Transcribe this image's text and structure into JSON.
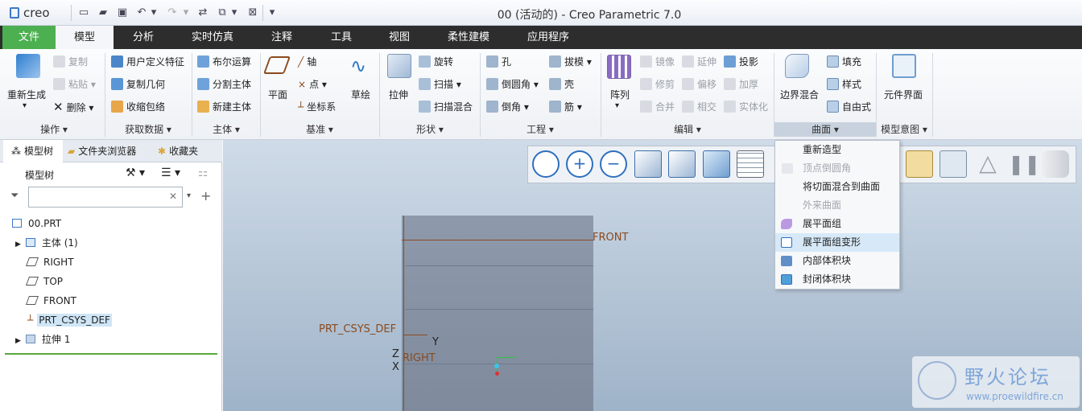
{
  "window": {
    "app_logo": "creo",
    "title": "00 (活动的) - Creo Parametric 7.0"
  },
  "ribbon_tabs": [
    "文件",
    "模型",
    "分析",
    "实时仿真",
    "注释",
    "工具",
    "视图",
    "柔性建模",
    "应用程序"
  ],
  "active_tab": "模型",
  "ribbon": {
    "operations": {
      "label": "操作",
      "regen": "重新生成",
      "copy": "复制",
      "paste": "粘贴",
      "delete": "删除"
    },
    "get_data": {
      "label": "获取数据",
      "udf": "用户定义特征",
      "copy_geom": "复制几何",
      "shrinkwrap": "收缩包络"
    },
    "body": {
      "label": "主体",
      "boolean": "布尔运算",
      "split": "分割主体",
      "new_body": "新建主体"
    },
    "datum": {
      "label": "基准",
      "plane": "平面",
      "axis": "轴",
      "point": "点",
      "csys": "坐标系",
      "sketch": "草绘"
    },
    "shapes": {
      "label": "形状",
      "extrude": "拉伸",
      "revolve": "旋转",
      "sweep": "扫描",
      "swept_blend": "扫描混合"
    },
    "engineering": {
      "label": "工程",
      "hole": "孔",
      "round": "倒圆角",
      "chamfer": "倒角",
      "draft": "拔模",
      "shell": "壳",
      "rib": "筋"
    },
    "editing": {
      "label": "编辑",
      "pattern": "阵列",
      "mirror": "镜像",
      "extend": "延伸",
      "project": "投影",
      "trim": "修剪",
      "offset": "偏移",
      "thicken": "加厚",
      "merge": "合并",
      "intersect": "相交",
      "solidify": "实体化"
    },
    "surfaces": {
      "label": "曲面",
      "boundary_blend": "边界混合",
      "fill": "填充",
      "style": "样式",
      "freestyle": "自由式"
    },
    "model_intent": {
      "label": "模型意图",
      "component_interface": "元件界面"
    }
  },
  "nav_tabs": [
    "模型树",
    "文件夹浏览器",
    "收藏夹"
  ],
  "model_tree": {
    "header": "模型树",
    "items": [
      "00.PRT",
      "主体 (1)",
      "RIGHT",
      "TOP",
      "FRONT",
      "PRT_CSYS_DEF",
      "拉伸 1"
    ]
  },
  "surfaces_menu": {
    "items": [
      "重新造型",
      "顶点倒圆角",
      "将切面混合到曲面",
      "外来曲面",
      "展平面组",
      "展平面组变形",
      "内部体积块",
      "封闭体积块"
    ]
  },
  "viewport": {
    "front_label": "FRONT",
    "csys_label": "PRT_CSYS_DEF",
    "right_label": "RIGHT",
    "axis_y": "Y",
    "axis_z": "Z",
    "axis_x": "X"
  },
  "watermark": {
    "title": "野火论坛",
    "url": "www.proewildfire.cn"
  },
  "colors": {
    "file_tab": "#4caf50",
    "tab_bar": "#2d2d2d",
    "datum": "#8a4a1f",
    "highlight": "#d7e9f8"
  }
}
